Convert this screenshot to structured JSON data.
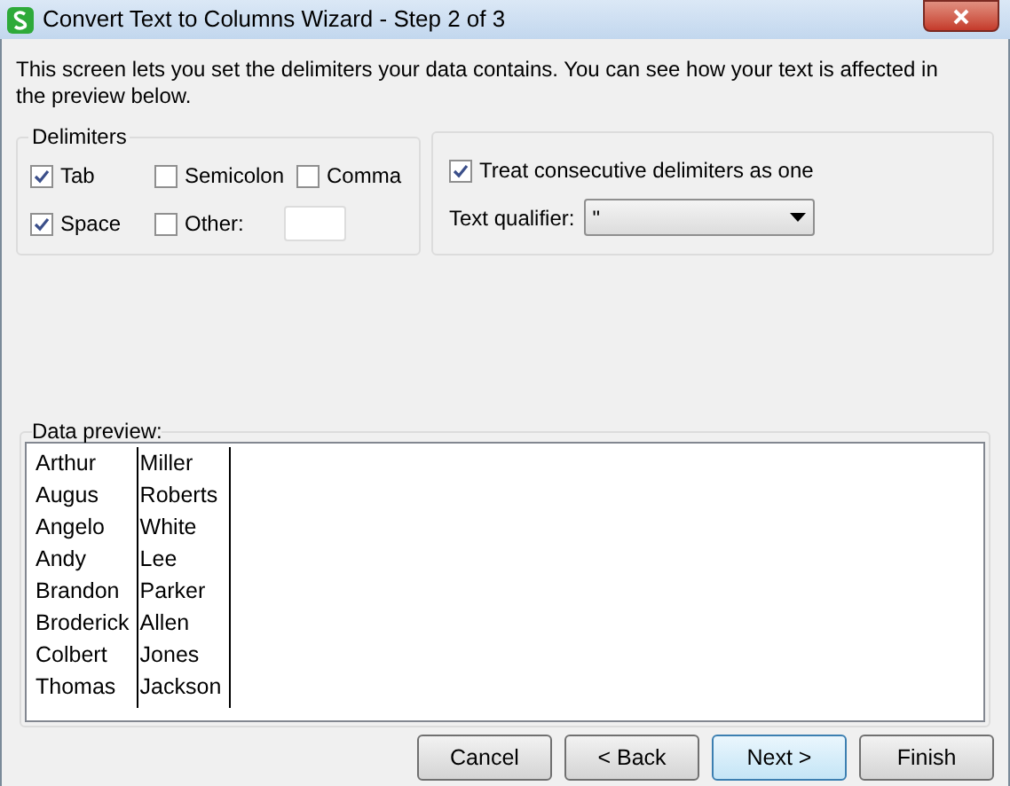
{
  "window": {
    "title": "Convert Text to Columns Wizard - Step 2 of 3"
  },
  "intro": "This screen lets you set the delimiters your data contains. You can see how your text is affected in the preview below.",
  "delimiters": {
    "title": "Delimiters",
    "options": [
      {
        "label": "Tab",
        "checked": true
      },
      {
        "label": "Semicolon",
        "checked": false
      },
      {
        "label": "Comma",
        "checked": false
      },
      {
        "label": "Space",
        "checked": true
      },
      {
        "label": "Other:",
        "checked": false
      }
    ]
  },
  "treat_consecutive": {
    "label": "Treat consecutive delimiters as one",
    "checked": true
  },
  "text_qualifier": {
    "label": "Text qualifier:",
    "value": "\""
  },
  "preview": {
    "title": "Data preview:",
    "rows": [
      [
        "Arthur",
        "Miller"
      ],
      [
        "Augus",
        "Roberts"
      ],
      [
        "Angelo",
        "White"
      ],
      [
        "Andy",
        "Lee"
      ],
      [
        "Brandon",
        "Parker"
      ],
      [
        "Broderick",
        "Allen"
      ],
      [
        "Colbert",
        "Jones"
      ],
      [
        "Thomas",
        "Jackson"
      ]
    ]
  },
  "buttons": [
    {
      "label": "Cancel",
      "focused": false
    },
    {
      "label": "< Back",
      "focused": false
    },
    {
      "label": "Next >",
      "focused": true
    },
    {
      "label": "Finish",
      "focused": false
    }
  ]
}
